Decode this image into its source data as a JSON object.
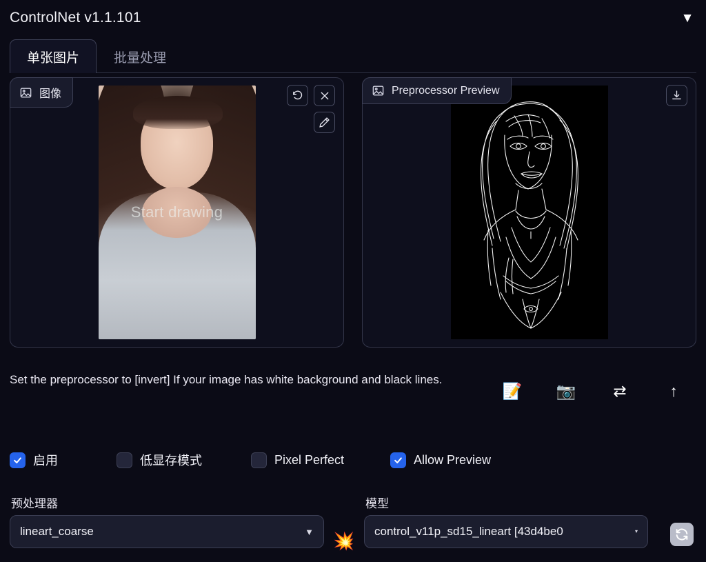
{
  "header": {
    "title": "ControlNet v1.1.101",
    "collapse_icon": "triangle-down-icon"
  },
  "tabs": [
    {
      "label": "单张图片",
      "active": true
    },
    {
      "label": "批量处理",
      "active": false
    }
  ],
  "image_panel": {
    "header_label": "图像",
    "header_icon": "image-icon",
    "overlay_text": "Start drawing",
    "actions": [
      {
        "name": "undo-button",
        "icon": "undo-icon"
      },
      {
        "name": "clear-button",
        "icon": "close-icon"
      },
      {
        "name": "draw-button",
        "icon": "pencil-icon"
      }
    ]
  },
  "preview_panel": {
    "header_label": "Preprocessor Preview",
    "header_icon": "image-icon",
    "actions": [
      {
        "name": "download-button",
        "icon": "download-icon"
      }
    ]
  },
  "hint": {
    "text": "Set the preprocessor to [invert] If your image has white background and black lines.",
    "icons": [
      {
        "name": "open-new-canvas-icon",
        "glyph": "📝"
      },
      {
        "name": "camera-icon",
        "glyph": "📷"
      },
      {
        "name": "swap-icon",
        "glyph": "⇄"
      },
      {
        "name": "send-dimensions-icon",
        "glyph": "↑"
      }
    ]
  },
  "checkboxes": [
    {
      "label": "启用",
      "checked": true
    },
    {
      "label": "低显存模式",
      "checked": false
    },
    {
      "label": "Pixel Perfect",
      "checked": false
    },
    {
      "label": "Allow Preview",
      "checked": true
    }
  ],
  "preprocessor": {
    "label": "预处理器",
    "value": "lineart_coarse",
    "caret": "▼",
    "run_icon": "💥"
  },
  "model": {
    "label": "模型",
    "value": "control_v11p_sd15_lineart [43d4be0",
    "caret": "▾",
    "refresh_icon": "refresh-icon"
  },
  "colors": {
    "background": "#0b0b16",
    "panel_bg": "#0e0f1d",
    "border": "#33364a",
    "accent_checked": "#2563eb",
    "text": "#f0f0f5"
  }
}
